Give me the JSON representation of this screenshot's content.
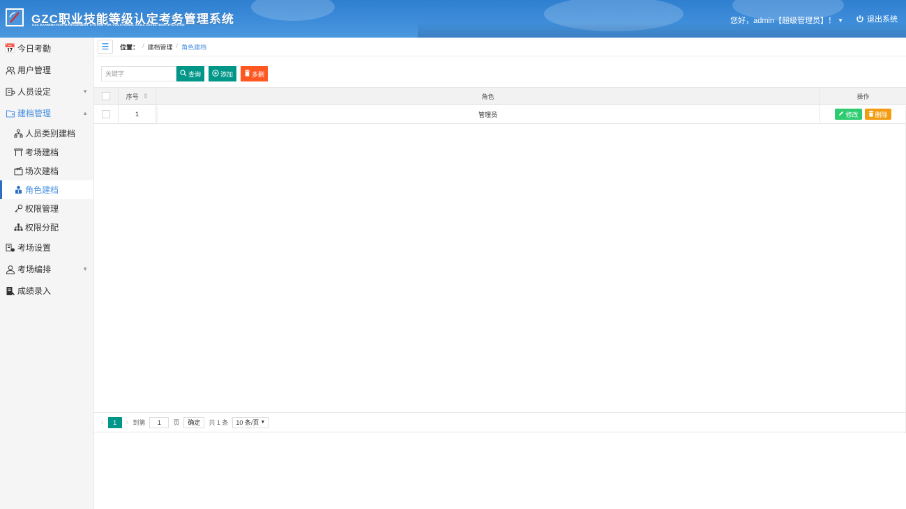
{
  "header": {
    "title": "GZC职业技能等级认定考务管理系统",
    "subtitle": "GZC EXAMINATION MANAGEMENT SYSTEM FOR VOCATIONAL SKILL LEVEL IDENTIFICATION",
    "greeting": "您好，admin【超级管理员】！",
    "logout_label": "退出系统"
  },
  "sidebar": {
    "items": [
      {
        "label": "今日考勤",
        "icon": "calendar-icon"
      },
      {
        "label": "用户管理",
        "icon": "users-icon"
      },
      {
        "label": "人员设定",
        "icon": "person-settings-icon"
      },
      {
        "label": "建档管理",
        "icon": "folder-icon"
      },
      {
        "label": "考场设置",
        "icon": "room-settings-icon"
      },
      {
        "label": "考场编排",
        "icon": "user-icon"
      },
      {
        "label": "成绩录入",
        "icon": "score-icon"
      }
    ],
    "sub_items": [
      {
        "label": "人员类别建档",
        "icon": "org-icon"
      },
      {
        "label": "考场建档",
        "icon": "table-icon"
      },
      {
        "label": "场次建档",
        "icon": "clapboard-icon"
      },
      {
        "label": "角色建档",
        "icon": "role-icon"
      },
      {
        "label": "权限管理",
        "icon": "key-icon"
      },
      {
        "label": "权限分配",
        "icon": "hierarchy-icon"
      }
    ]
  },
  "breadcrumb": {
    "prefix": "位置：",
    "sep": "/",
    "items": [
      "建档管理",
      "角色建档"
    ]
  },
  "toolbar": {
    "search_placeholder": "关键字",
    "query_label": "查询",
    "add_label": "添加",
    "multi_delete_label": "多删"
  },
  "table": {
    "columns": [
      "序号",
      "角色",
      "操作"
    ],
    "rows": [
      {
        "no": "1",
        "role": "管理员"
      }
    ],
    "edit_label": "修改",
    "delete_label": "删除"
  },
  "pager": {
    "current_page": "1",
    "goto_label": "到第",
    "goto_value": "1",
    "page_unit": "页",
    "confirm_label": "确定",
    "total_label": "共 1 条",
    "page_size": "10 条/页"
  },
  "colors": {
    "header": "#3a8ad8",
    "accent_green": "#009688",
    "accent_red": "#ff5722",
    "active_blue": "#2e6fc4"
  }
}
